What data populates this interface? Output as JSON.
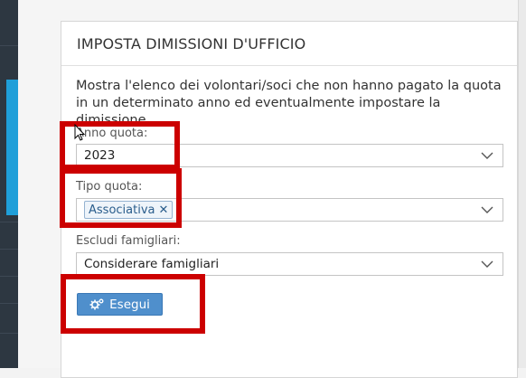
{
  "panel": {
    "title": "IMPOSTA DIMISSIONI D'UFFICIO",
    "description": "Mostra l'elenco dei volontari/soci che non hanno pagato la quota in un determinato anno ed eventualmente impostare la dimissione"
  },
  "fields": {
    "anno_quota": {
      "label": "Anno quota:",
      "value": "2023"
    },
    "tipo_quota": {
      "label": "Tipo quota:",
      "token": "Associativa",
      "token_remove": "✕"
    },
    "escludi_famigliari": {
      "label": "Escludi famigliari:",
      "value": "Considerare famigliari"
    }
  },
  "actions": {
    "esegui_label": "Esegui",
    "esegui_icon": "gears-icon"
  },
  "colors": {
    "accent": "#1f9fd9",
    "button": "#4f8fcc",
    "highlight": "#cc0000"
  }
}
